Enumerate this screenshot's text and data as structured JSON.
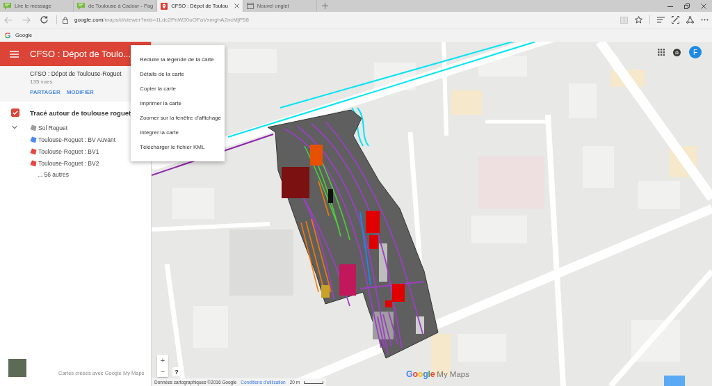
{
  "browser": {
    "tabs": [
      {
        "title": "Lire le message",
        "selected": false
      },
      {
        "title": "de Toulouse à Cadour - Pag",
        "selected": false
      },
      {
        "title": "CFSO : Dépot de Toulou",
        "selected": true
      },
      {
        "title": "Nouvel onglet",
        "selected": false
      }
    ],
    "navigation": {
      "back": {
        "disabled": true
      },
      "forward": {
        "disabled": true
      }
    },
    "address": {
      "host": "google.com",
      "path": "/maps/d/viewer?mid=1Ldc2PnW20uOFaVxmghA2ncMjP58"
    },
    "favorites": [
      {
        "label": "Google"
      }
    ]
  },
  "panel": {
    "title": "CFSO : Dépot de Toulo...",
    "map_name": "CFSO : Dépot de Toulouse-Roguet",
    "views": "135 vues",
    "actions": [
      "PARTAGER",
      "MODIFIER"
    ],
    "layer": {
      "name": "Tracé autour de toulouse roguet",
      "checked": true,
      "expanded": true,
      "features": [
        {
          "name": "Sol Roguet",
          "color": "#9e9e9e"
        },
        {
          "name": "Toulouse-Roguet : BV Auvant",
          "color": "#4a89f3"
        },
        {
          "name": "Toulouse-Roguet : BV1",
          "color": "#e8453c"
        },
        {
          "name": "Toulouse-Roguet : BV2",
          "color": "#e8453c"
        }
      ],
      "more": "... 56 autres"
    },
    "footer": "Cartes créées avec Google My Maps"
  },
  "menu": {
    "items": [
      "Réduire la légende de la carte",
      "Détails de la carte",
      "Copier la carte",
      "Imprimer la carte",
      "Zoomer sur la fenêtre d'affichage",
      "Intégrer la carte",
      "Télécharger le fichier KML"
    ]
  },
  "map": {
    "account_initial": "F",
    "zoom_in": "+",
    "zoom_out": "−",
    "help": "?",
    "logo": {
      "brand": "Google",
      "product": "My Maps"
    },
    "attribution": "Données cartographiques ©2016 Google",
    "terms": "Conditions d'utilisation",
    "scale": "20 m"
  }
}
